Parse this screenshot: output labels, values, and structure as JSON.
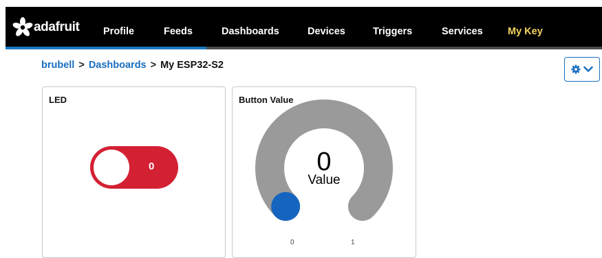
{
  "brand": {
    "name": "adafruit",
    "logo_icon": "adafruit-flower-icon"
  },
  "nav": {
    "items": [
      {
        "label": "Profile"
      },
      {
        "label": "Feeds"
      },
      {
        "label": "Dashboards",
        "active": true
      },
      {
        "label": "Devices"
      },
      {
        "label": "Triggers"
      },
      {
        "label": "Services"
      },
      {
        "label": "My Key",
        "highlight": "#f4d35e"
      }
    ]
  },
  "breadcrumb": {
    "user": "brubell",
    "section": "Dashboards",
    "current": "My ESP32-S2",
    "separator": ">"
  },
  "settings": {
    "icon": "gear-icon",
    "dropdown_icon": "chevron-down-icon"
  },
  "blocks": {
    "led": {
      "title": "LED",
      "toggle_state": "0",
      "on": false,
      "color": "#d42033"
    },
    "button_value": {
      "title": "Button Value",
      "value": "0",
      "label": "Value",
      "min": "0",
      "max": "1",
      "fill_fraction": 0,
      "track_color": "#9a9a9a",
      "indicator_color": "#1565c0"
    }
  },
  "colors": {
    "link": "#1a6fbf",
    "nav_bg": "#000000",
    "nav_active": "#1a78c2"
  }
}
